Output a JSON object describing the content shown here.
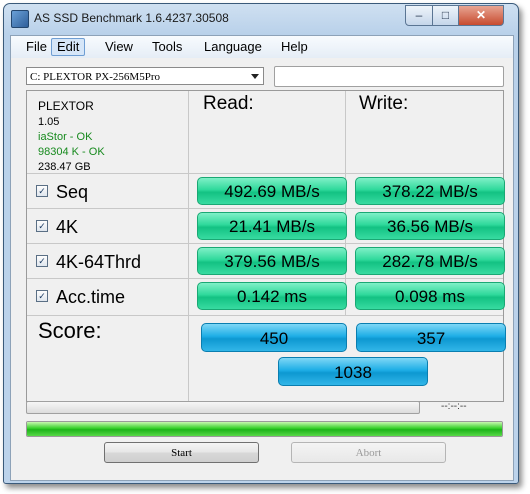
{
  "window": {
    "title": "AS SSD Benchmark 1.6.4237.30508"
  },
  "menu": [
    "File",
    "Edit",
    "View",
    "Tools",
    "Language",
    "Help"
  ],
  "drive_select": {
    "value": "C: PLEXTOR PX-256M5Pro"
  },
  "info": {
    "model": "PLEXTOR",
    "firmware": "1.05",
    "driver": "iaStor - OK",
    "alignment": "98304 K - OK",
    "size": "238.47 GB"
  },
  "columns": {
    "read": "Read:",
    "write": "Write:"
  },
  "rows": [
    {
      "label": "Seq",
      "checked": true,
      "read": "492.69 MB/s",
      "write": "378.22 MB/s"
    },
    {
      "label": "4K",
      "checked": true,
      "read": "21.41 MB/s",
      "write": "36.56 MB/s"
    },
    {
      "label": "4K-64Thrd",
      "checked": true,
      "read": "379.56 MB/s",
      "write": "282.78 MB/s"
    },
    {
      "label": "Acc.time",
      "checked": true,
      "read": "0.142 ms",
      "write": "0.098 ms"
    }
  ],
  "score": {
    "label": "Score:",
    "read": "450",
    "write": "357",
    "total": "1038"
  },
  "progress": {
    "time": "--:--:--",
    "overall_fraction": 1.0
  },
  "buttons": {
    "start": "Start",
    "abort": "Abort"
  },
  "colors": {
    "value_box": "#2fd99b",
    "score_box": "#1eaee6",
    "progress": "#1db41a",
    "ok_text": "#178a1e"
  },
  "icons": {
    "check": "✓",
    "minimize": "‒",
    "maximize": "□",
    "close": "✕"
  }
}
